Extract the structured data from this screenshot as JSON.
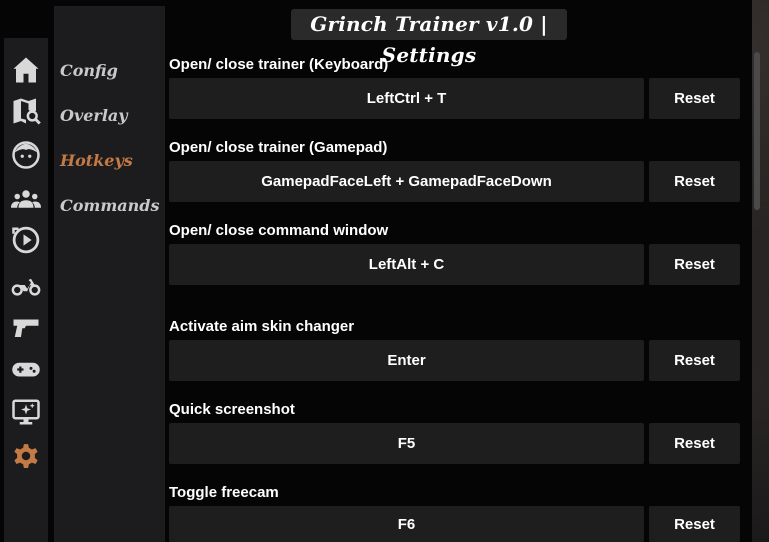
{
  "window": {
    "title": "Grinch Trainer v1.0 | Settings"
  },
  "iconbar": {
    "items": [
      {
        "icon": "home-icon"
      },
      {
        "icon": "map-search-icon"
      },
      {
        "icon": "face-icon"
      },
      {
        "icon": "people-icon"
      },
      {
        "icon": "play-circle-icon"
      },
      {
        "icon": "motorcycle-icon"
      },
      {
        "icon": "pistol-icon"
      },
      {
        "icon": "gamepad-icon"
      },
      {
        "icon": "monitor-sparkle-icon"
      },
      {
        "icon": "gear-icon",
        "active": true
      }
    ],
    "active_color": "#c47a45",
    "icon_color": "#d8d8d8"
  },
  "subnav": {
    "items": [
      {
        "label": "Config"
      },
      {
        "label": "Overlay"
      },
      {
        "label": "Hotkeys",
        "active": true
      },
      {
        "label": "Commands"
      }
    ]
  },
  "hotkeys": [
    {
      "label": "Open/ close trainer (Keyboard)",
      "value": "LeftCtrl + T",
      "reset": "Reset"
    },
    {
      "label": "Open/ close trainer (Gamepad)",
      "value": "GamepadFaceLeft + GamepadFaceDown",
      "reset": "Reset"
    },
    {
      "label": "Open/ close command window",
      "value": "LeftAlt + C",
      "reset": "Reset"
    },
    {
      "label": "Activate aim skin changer",
      "value": "Enter",
      "reset": "Reset"
    },
    {
      "label": "Quick screenshot",
      "value": "F5",
      "reset": "Reset"
    },
    {
      "label": "Toggle freecam",
      "value": "F6",
      "reset": "Reset"
    }
  ]
}
